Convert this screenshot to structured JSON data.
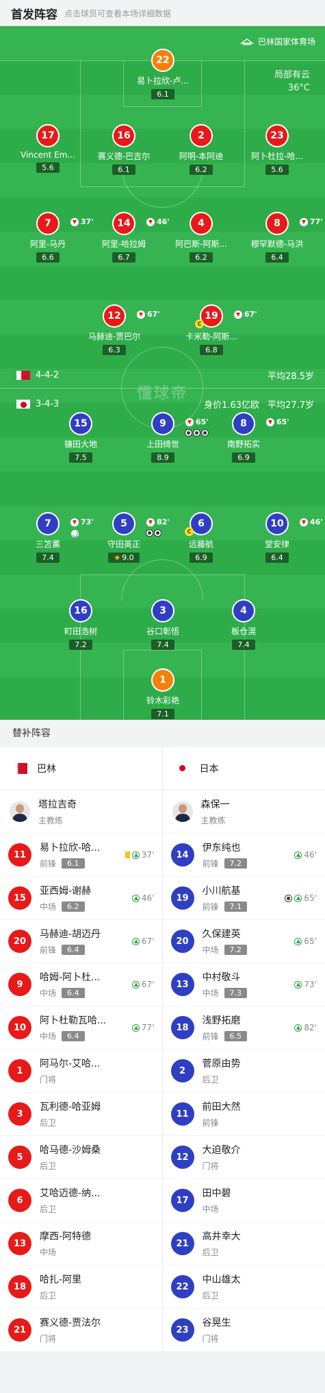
{
  "header": {
    "title": "首发阵容",
    "subtitle": "点击球员可查看本场详细数据"
  },
  "pitch": {
    "venue": "巴林国家体育场",
    "weather": "局部有云",
    "temperature": "36°C",
    "watermark": "懂球帝",
    "home": {
      "formation": "4-4-2",
      "avg_age": "平均28.5岁"
    },
    "away": {
      "formation": "3-4-3",
      "value": "身价1.63亿欧",
      "avg_age": "平均27.7岁"
    }
  },
  "home_players": [
    {
      "num": "22",
      "name": "易卜拉欣-卢...",
      "rating": "6.1",
      "gk": true
    },
    {
      "num": "17",
      "name": "Vincent Em...",
      "rating": "5.6"
    },
    {
      "num": "16",
      "name": "赛义德-巴吉尔",
      "rating": "6.1"
    },
    {
      "num": "2",
      "name": "阿明-本阿迪",
      "rating": "6.2"
    },
    {
      "num": "23",
      "name": "阿卜杜拉-哈...",
      "rating": "5.6"
    },
    {
      "num": "7",
      "name": "阿里-马丹",
      "rating": "6.6",
      "sub": "37'"
    },
    {
      "num": "14",
      "name": "阿里-哈拉姆",
      "rating": "6.7",
      "sub": "46'"
    },
    {
      "num": "4",
      "name": "阿巴斯-阿斯...",
      "rating": "6.2"
    },
    {
      "num": "8",
      "name": "穆罕默德-马洪",
      "rating": "6.4",
      "sub": "77'"
    },
    {
      "num": "12",
      "name": "马赫迪-贾巴尔",
      "rating": "6.3",
      "sub": "67'"
    },
    {
      "num": "19",
      "name": "卡米勒-阿斯...",
      "rating": "6.8",
      "sub": "67'",
      "captain": "C"
    }
  ],
  "away_players": [
    {
      "num": "15",
      "name": "镰田大地",
      "rating": "7.5"
    },
    {
      "num": "9",
      "name": "上田绮世",
      "rating": "8.9",
      "sub": "65'"
    },
    {
      "num": "8",
      "name": "南野拓实",
      "rating": "6.9",
      "sub": "65'"
    },
    {
      "num": "7",
      "name": "三笘薰",
      "rating": "7.4",
      "sub": "73'"
    },
    {
      "num": "5",
      "name": "守田英正",
      "rating": "9.0",
      "sub": "82'",
      "star": "★"
    },
    {
      "num": "6",
      "name": "远藤航",
      "rating": "6.9",
      "captain": "C"
    },
    {
      "num": "10",
      "name": "堂安律",
      "rating": "6.4",
      "sub": "46'"
    },
    {
      "num": "16",
      "name": "町田浩树",
      "rating": "7.2"
    },
    {
      "num": "3",
      "name": "谷口彰悟",
      "rating": "7.4"
    },
    {
      "num": "4",
      "name": "板仓滉",
      "rating": "7.4"
    },
    {
      "num": "1",
      "name": "铃木彩艳",
      "rating": "7.1",
      "gk": true
    }
  ],
  "subs": {
    "title": "替补阵容",
    "home_team": "巴林",
    "away_team": "日本",
    "home_coach": {
      "name": "塔拉吉奇",
      "role": "主教练"
    },
    "away_coach": {
      "name": "森保一",
      "role": "主教练"
    },
    "home": [
      {
        "num": "11",
        "name": "易卜拉欣-哈...",
        "pos": "前锋",
        "rating": "6.1",
        "time": "37'",
        "yellow": true
      },
      {
        "num": "15",
        "name": "亚西姆-谢赫",
        "pos": "中场",
        "rating": "6.2",
        "time": "46'"
      },
      {
        "num": "20",
        "name": "马赫迪-胡迈丹",
        "pos": "前锋",
        "rating": "6.4",
        "time": "67'"
      },
      {
        "num": "9",
        "name": "哈姆-阿卜杜...",
        "pos": "中场",
        "rating": "6.4",
        "time": "67'"
      },
      {
        "num": "10",
        "name": "阿卜杜勒瓦哈...",
        "pos": "中场",
        "rating": "6.4",
        "time": "77'"
      },
      {
        "num": "1",
        "name": "阿马尔-艾哈...",
        "pos": "门将"
      },
      {
        "num": "3",
        "name": "瓦利德-哈亚姆",
        "pos": "后卫"
      },
      {
        "num": "5",
        "name": "哈马德-沙姆桑",
        "pos": "后卫"
      },
      {
        "num": "6",
        "name": "艾哈迈德-纳...",
        "pos": "后卫"
      },
      {
        "num": "13",
        "name": "摩西-阿特德",
        "pos": "中场"
      },
      {
        "num": "18",
        "name": "哈扎-阿里",
        "pos": "后卫"
      },
      {
        "num": "21",
        "name": "赛义德-贾法尔",
        "pos": "门将"
      }
    ],
    "away": [
      {
        "num": "14",
        "name": "伊东纯也",
        "pos": "前锋",
        "rating": "7.2",
        "time": "46'"
      },
      {
        "num": "19",
        "name": "小川航基",
        "pos": "前锋",
        "rating": "7.1",
        "time": "65'",
        "goal": true
      },
      {
        "num": "20",
        "name": "久保建英",
        "pos": "中场",
        "rating": "7.2",
        "time": "65'"
      },
      {
        "num": "13",
        "name": "中村敬斗",
        "pos": "中场",
        "rating": "7.3",
        "time": "73'"
      },
      {
        "num": "18",
        "name": "浅野拓磨",
        "pos": "前锋",
        "rating": "6.5",
        "time": "82'"
      },
      {
        "num": "2",
        "name": "菅原由势",
        "pos": "后卫"
      },
      {
        "num": "11",
        "name": "前田大然",
        "pos": "前锋"
      },
      {
        "num": "12",
        "name": "大迫敬介",
        "pos": "门将"
      },
      {
        "num": "17",
        "name": "田中碧",
        "pos": "中场"
      },
      {
        "num": "21",
        "name": "高井幸大",
        "pos": "后卫"
      },
      {
        "num": "22",
        "name": "中山雄太",
        "pos": "后卫"
      },
      {
        "num": "23",
        "name": "谷晃生",
        "pos": "门将"
      }
    ]
  },
  "colors": {
    "home": "#e81919",
    "away": "#2f3fc4",
    "gk_home": "#f77f0a",
    "gk_away": "#f77f0a",
    "pitch": "#2fac4a"
  }
}
